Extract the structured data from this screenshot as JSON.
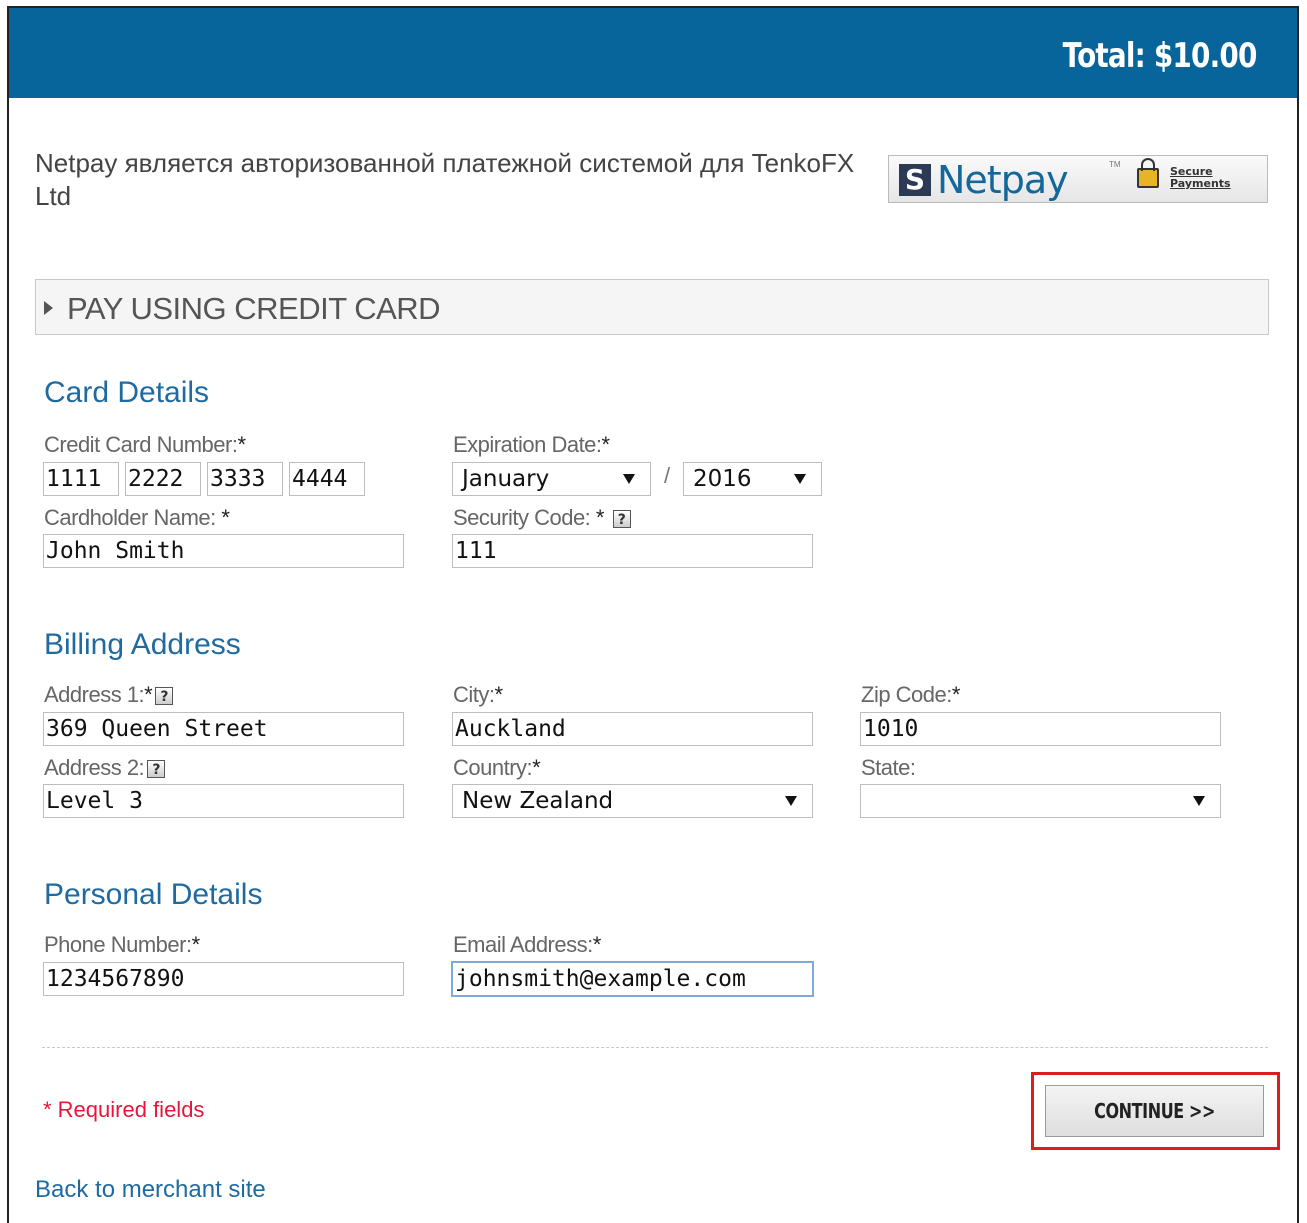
{
  "header": {
    "total_text": "Total:  $10.00"
  },
  "intro": {
    "text": "Netpay является авторизованной платежной системой для TenkoFX Ltd"
  },
  "badge": {
    "logo_s": "S",
    "logo_text": "Netpay",
    "tm": "TM",
    "secure_line1": "Secure",
    "secure_line2": "Payments"
  },
  "pay_section": {
    "label": "PAY USING CREDIT CARD"
  },
  "card_details": {
    "title": "Card Details",
    "card_number_label": "Credit Card Number:",
    "card_number_parts": [
      "1111",
      "2222",
      "3333",
      "4444"
    ],
    "expiration_label": "Expiration Date:",
    "expiration_month": "January",
    "expiration_year": "2016",
    "expiration_separator": "/",
    "cardholder_label": "Cardholder Name:",
    "cardholder_value": "John Smith",
    "security_label": "Security Code:",
    "security_value": "111"
  },
  "billing": {
    "title": "Billing Address",
    "address1_label": "Address 1:",
    "address1_value": "369 Queen Street",
    "city_label": "City:",
    "city_value": "Auckland",
    "zip_label": "Zip Code:",
    "zip_value": "1010",
    "address2_label": "Address 2:",
    "address2_value": "Level 3",
    "country_label": "Country:",
    "country_value": "New Zealand",
    "state_label": "State:",
    "state_value": ""
  },
  "personal": {
    "title": "Personal Details",
    "phone_label": "Phone Number:",
    "phone_value": "1234567890",
    "email_label": "Email Address:",
    "email_value": "johnsmith@example.com"
  },
  "footer": {
    "required_note": "* Required fields",
    "continue_label": "CONTINUE >>",
    "back_link": "Back to merchant site"
  },
  "required_marker": "*",
  "help_glyph": "?",
  "colors": {
    "header_bg": "#07659b",
    "section_title": "#1f6aa0",
    "required_text": "#e8143a",
    "highlight_box": "#dd1c1c"
  }
}
